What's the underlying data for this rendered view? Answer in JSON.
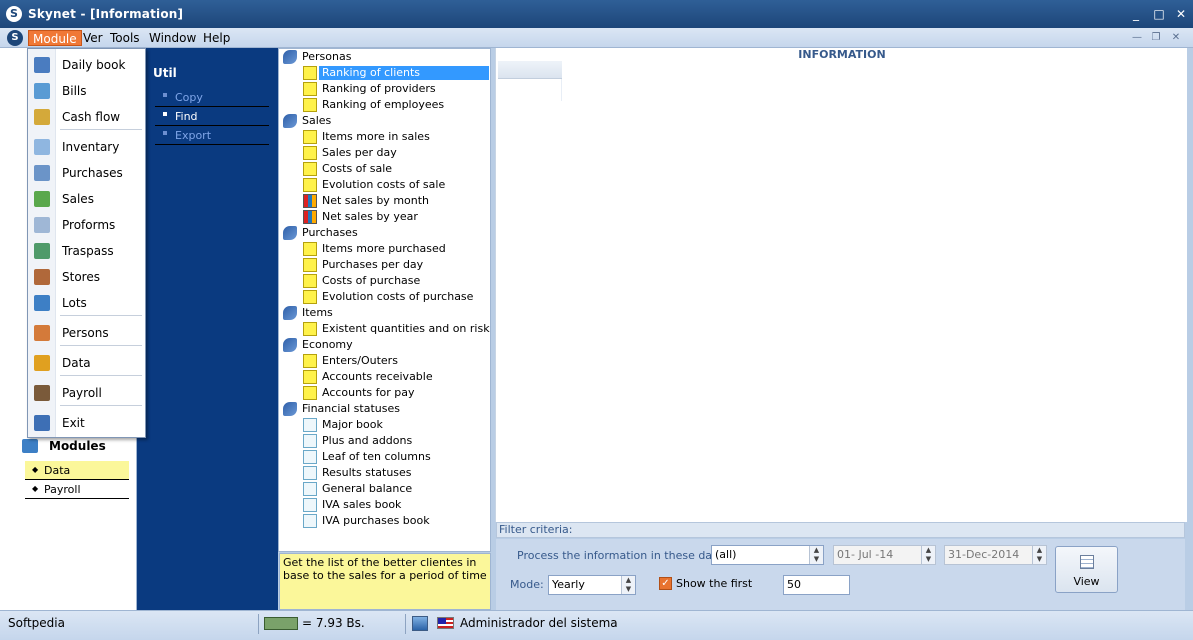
{
  "window": {
    "title": "Skynet - [Information]",
    "app_icon_glyph": "S",
    "controls": {
      "minimize": "_",
      "maximize": "□",
      "close": "✕"
    }
  },
  "menubar": {
    "items": [
      "Module",
      "Ver",
      "Tools",
      "Window",
      "Help"
    ],
    "active": "Module",
    "mdi_controls": {
      "minimize": "—",
      "restore": "❐",
      "close": "✕"
    }
  },
  "module_menu": {
    "items": [
      {
        "label": "Daily book",
        "icon": "book-icon",
        "color": "#4a7cc0"
      },
      {
        "label": "Bills",
        "icon": "bills-icon",
        "color": "#5a9bd4"
      },
      {
        "label": "Cash flow",
        "icon": "cash-icon",
        "color": "#d4a93a"
      },
      {
        "label": "Inventary",
        "icon": "grid-icon",
        "color": "#8fb6e0"
      },
      {
        "label": "Purchases",
        "icon": "cart-icon",
        "color": "#6b94c8"
      },
      {
        "label": "Sales",
        "icon": "basket-icon",
        "color": "#5aa84c"
      },
      {
        "label": "Proforms",
        "icon": "document-icon",
        "color": "#9fb7d6"
      },
      {
        "label": "Traspass",
        "icon": "transfer-icon",
        "color": "#4f9a6a"
      },
      {
        "label": "Stores",
        "icon": "store-icon",
        "color": "#b0683a"
      },
      {
        "label": "Lots",
        "icon": "lots-icon",
        "color": "#3d7fc5"
      },
      {
        "label": "Persons",
        "icon": "people-icon",
        "color": "#d47a3a"
      },
      {
        "label": "Data",
        "icon": "bar-chart-icon",
        "color": "#e0a020"
      },
      {
        "label": "Payroll",
        "icon": "person-icon",
        "color": "#7a5a3a"
      },
      {
        "label": "Exit",
        "icon": "exit-icon",
        "color": "#3d6fb5"
      }
    ]
  },
  "util": {
    "title": "Util",
    "items": [
      {
        "label": "Copy",
        "active": false
      },
      {
        "label": "Find",
        "active": true
      },
      {
        "label": "Export",
        "active": false
      }
    ]
  },
  "modules": {
    "title": "Modules",
    "items": [
      {
        "label": "Data",
        "selected": true
      },
      {
        "label": "Payroll",
        "selected": false
      }
    ]
  },
  "tree": {
    "categories": [
      {
        "label": "Personas",
        "children": [
          {
            "label": "Ranking of clients",
            "icon": "note",
            "selected": true
          },
          {
            "label": "Ranking of providers",
            "icon": "note"
          },
          {
            "label": "Ranking of employees",
            "icon": "note"
          }
        ]
      },
      {
        "label": "Sales",
        "children": [
          {
            "label": "Items more in sales",
            "icon": "note"
          },
          {
            "label": "Sales per day",
            "icon": "note"
          },
          {
            "label": "Costs of sale",
            "icon": "note"
          },
          {
            "label": "Evolution costs of sale",
            "icon": "note"
          },
          {
            "label": "Net sales by month",
            "icon": "chart"
          },
          {
            "label": "Net sales by year",
            "icon": "chart"
          }
        ]
      },
      {
        "label": "Purchases",
        "children": [
          {
            "label": "Items more purchased",
            "icon": "note"
          },
          {
            "label": "Purchases per day",
            "icon": "note"
          },
          {
            "label": "Costs of purchase",
            "icon": "note"
          },
          {
            "label": "Evolution costs of purchase",
            "icon": "note"
          }
        ]
      },
      {
        "label": "Items",
        "children": [
          {
            "label": "Existent quantities and on risk",
            "icon": "note"
          }
        ]
      },
      {
        "label": "Economy",
        "children": [
          {
            "label": "Enters/Outers",
            "icon": "note"
          },
          {
            "label": "Accounts receivable",
            "icon": "note"
          },
          {
            "label": "Accounts for pay",
            "icon": "note"
          }
        ]
      },
      {
        "label": "Financial statuses",
        "children": [
          {
            "label": "Major book",
            "icon": "plain"
          },
          {
            "label": "Plus and addons",
            "icon": "plain"
          },
          {
            "label": "Leaf of ten columns",
            "icon": "plain"
          },
          {
            "label": "Results statuses",
            "icon": "plain"
          },
          {
            "label": "General balance",
            "icon": "plain"
          },
          {
            "label": "IVA sales book",
            "icon": "plain"
          },
          {
            "label": "IVA purchases book",
            "icon": "plain"
          }
        ]
      }
    ]
  },
  "description": "Get the list of the better clientes in base to the sales for a period of time",
  "info": {
    "title": "INFORMATION"
  },
  "filter": {
    "header": "Filter criteria:",
    "dates_label": "Process the information in these dates:",
    "period_value": "(all)",
    "date_from": "01- Jul -14",
    "date_to": "31-Dec-2014",
    "mode_label": "Mode:",
    "mode_value": "Yearly",
    "show_first_label": "Show the first",
    "show_first_checked": true,
    "show_first_value": "50",
    "view_button": "View"
  },
  "status": {
    "left": "Softpedia",
    "rate": "= 7.93 Bs.",
    "user": "Administrador del sistema"
  }
}
